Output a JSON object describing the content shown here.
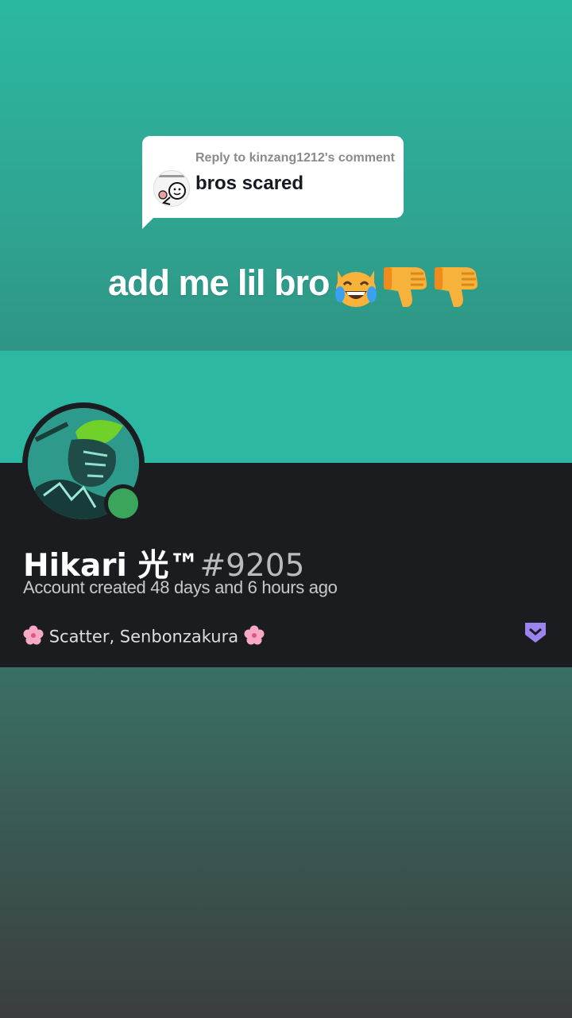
{
  "reply_card": {
    "header": "Reply to kinzang1212's comment",
    "text": "bros scared"
  },
  "caption": {
    "text": "add me lil bro",
    "emojis": [
      "cat-tears-of-joy-icon",
      "thumbs-down-icon",
      "thumbs-down-icon"
    ]
  },
  "profile": {
    "name": "Hikari 光™",
    "discriminator": "#9205",
    "created": "Account created 48 days and 6 hours ago",
    "custom_status": "Scatter, Senbonzakura",
    "status_color": "#3ba55c",
    "badge_icon": "hypesquad-icon",
    "badge_color": "#9c84ef",
    "banner_color": "#2db8a4"
  }
}
